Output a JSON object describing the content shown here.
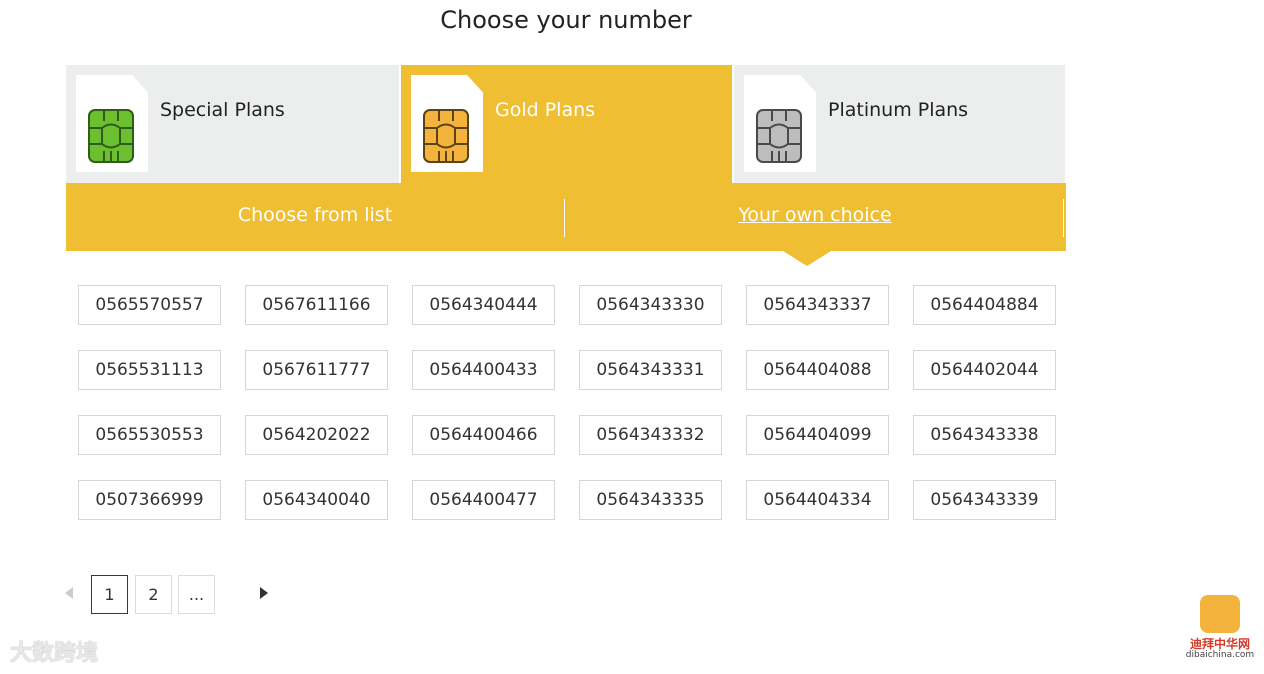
{
  "page": {
    "title": "Choose your number"
  },
  "plans": [
    {
      "label": "Special Plans",
      "chip_color": "#6cbf2e",
      "active": false
    },
    {
      "label": "Gold Plans",
      "chip_color": "#f3b33d",
      "active": true
    },
    {
      "label": "Platinum Plans",
      "chip_color": "#bdbdbd",
      "active": false
    }
  ],
  "modes": {
    "list_label": "Choose from list",
    "own_label": "Your own choice"
  },
  "numbers": [
    [
      "0565570557",
      "0567611166",
      "0564340444",
      "0564343330",
      "0564343337",
      "0564404884"
    ],
    [
      "0565531113",
      "0567611777",
      "0564400433",
      "0564343331",
      "0564404088",
      "0564402044"
    ],
    [
      "0565530553",
      "0564202022",
      "0564400466",
      "0564343332",
      "0564404099",
      "0564343338"
    ],
    [
      "0507366999",
      "0564340040",
      "0564400477",
      "0564343335",
      "0564404334",
      "0564343339"
    ]
  ],
  "pagination": {
    "page1": "1",
    "page2": "2",
    "more": "..."
  },
  "watermarks": {
    "left_text": "大数跨境",
    "right_cn": "迪拜中华网",
    "right_url": "dibaichina.com"
  },
  "colors": {
    "accent": "#f0be33",
    "tab_bg": "#eceeed"
  }
}
